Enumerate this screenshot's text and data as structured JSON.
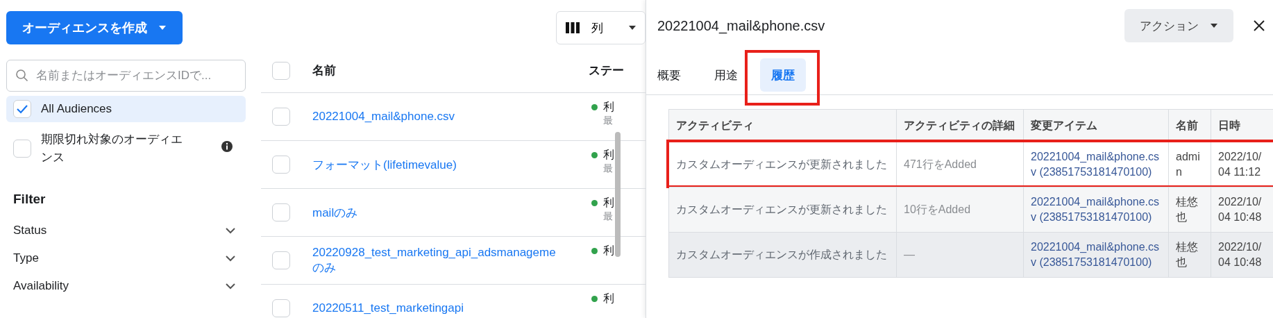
{
  "create_button": {
    "label": "オーディエンスを作成"
  },
  "columns_button": {
    "label": "列"
  },
  "search": {
    "placeholder": "名前またはオーディエンスIDで..."
  },
  "audience_filters": [
    {
      "label": "All Audiences",
      "checked": true,
      "selected": true,
      "info": false
    },
    {
      "label": "期限切れ対象のオーディエンス",
      "checked": false,
      "selected": false,
      "info": true
    }
  ],
  "filter": {
    "title": "Filter",
    "items": [
      {
        "label": "Status",
        "expanded": false
      },
      {
        "label": "Type",
        "expanded": false
      },
      {
        "label": "Availability",
        "expanded": false
      }
    ]
  },
  "audience_table": {
    "columns": [
      "名前",
      "ステー"
    ],
    "all_checked": false,
    "rows": [
      {
        "name_lines": [
          "20221004_mail&phone.csv"
        ],
        "status": "利",
        "status_detail": "最",
        "checked": false
      },
      {
        "name_lines": [
          "フォーマット(lifetimevalue)"
        ],
        "status": "利",
        "status_detail": "最",
        "checked": false
      },
      {
        "name_lines": [
          "mailのみ"
        ],
        "status": "利",
        "status_detail": "最",
        "checked": false
      },
      {
        "name_lines": [
          "20220928_test_marketing_api_adsmanageme",
          "のみ"
        ],
        "status": "利",
        "checked": false
      },
      {
        "name_lines": [
          "20220511_test_marketingapi"
        ],
        "status": "利",
        "checked": false
      }
    ]
  },
  "detail": {
    "title": "20221004_mail&phone.csv",
    "action_button": "アクション",
    "tabs": [
      {
        "label": "概要",
        "selected": false,
        "annotated": false
      },
      {
        "label": "用途",
        "selected": false,
        "annotated": false
      },
      {
        "label": "履歴",
        "selected": true,
        "annotated": true
      }
    ],
    "history_table": {
      "columns": [
        "アクティビティ",
        "アクティビティの詳細",
        "変更アイテム",
        "名前",
        "日時"
      ],
      "rows": [
        {
          "activity": "カスタムオーディエンスが更新されました",
          "detail": "471行をAdded",
          "item": "20221004_mail&phone.csv (23851753181470100)",
          "name": "admin",
          "datetime": "2022/10/04 11:12",
          "annotated": true,
          "hovered": false
        },
        {
          "activity": "カスタムオーディエンスが更新されました",
          "detail": "10行をAdded",
          "item": "20221004_mail&phone.csv (23851753181470100)",
          "name": "桂悠也",
          "datetime": "2022/10/04 10:48",
          "annotated": false,
          "hovered": false
        },
        {
          "activity": "カスタムオーディエンスが作成されました",
          "detail": "—",
          "item": "20221004_mail&phone.csv (23851753181470100)",
          "name": "桂悠也",
          "datetime": "2022/10/04 10:48",
          "annotated": false,
          "hovered": true
        }
      ]
    }
  }
}
